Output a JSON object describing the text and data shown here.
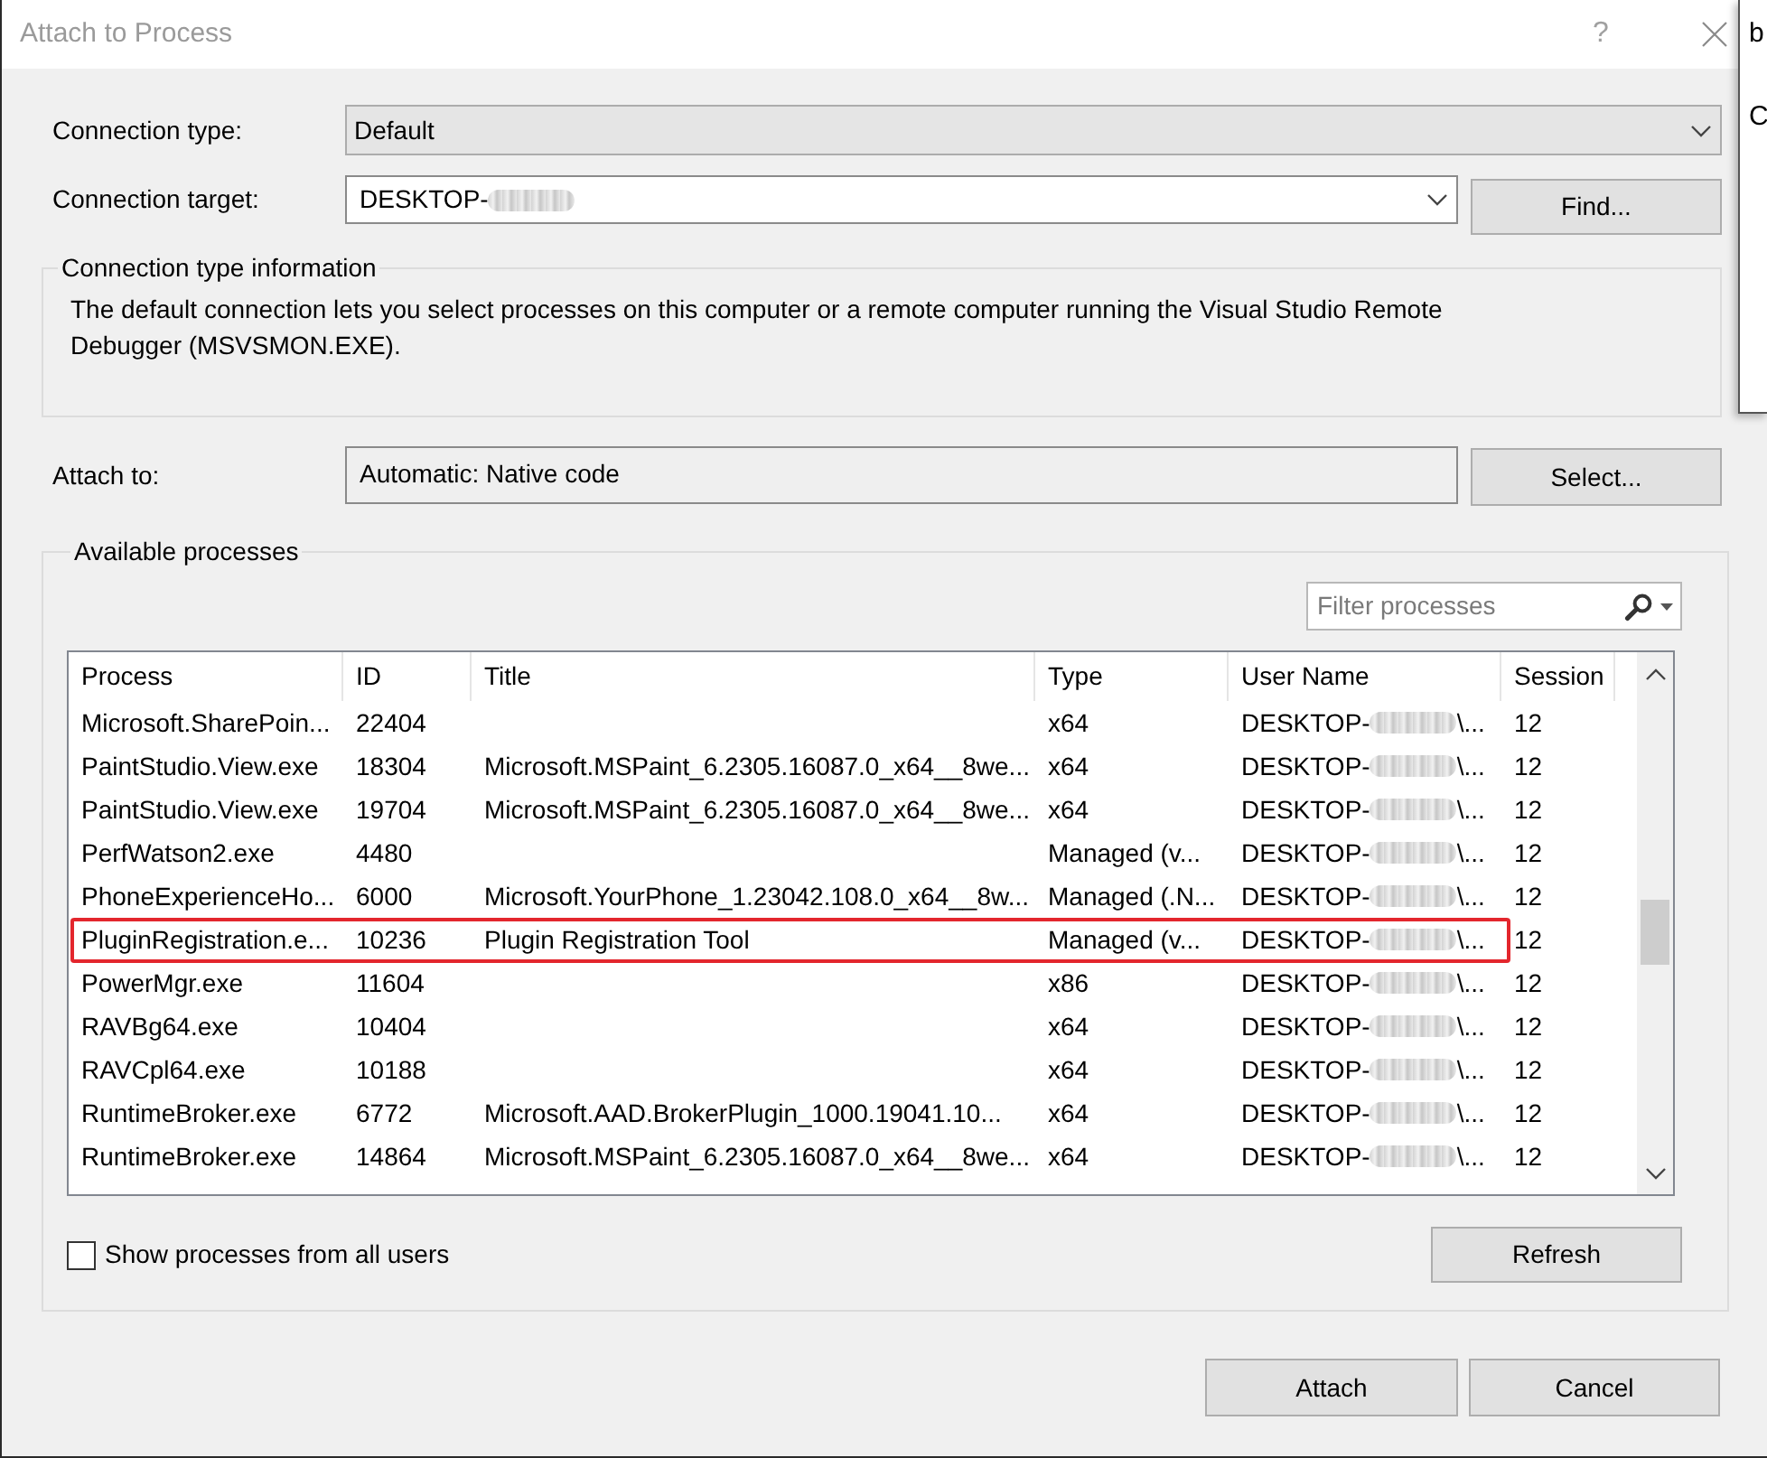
{
  "window": {
    "title": "Attach to Process",
    "help": "?"
  },
  "background_window": {
    "texts": [
      "b",
      "C"
    ]
  },
  "connection_type": {
    "label": "Connection type:",
    "value": "Default"
  },
  "connection_target": {
    "label": "Connection target:",
    "value": "DESKTOP-"
  },
  "find_button": "Find...",
  "connection_info": {
    "title": "Connection type information",
    "text": "The default connection lets you select processes on this computer or a remote computer running the Visual Studio Remote Debugger (MSVSMON.EXE)."
  },
  "attach_to": {
    "label": "Attach to:",
    "value": "Automatic: Native code"
  },
  "select_button": "Select...",
  "available_processes": {
    "title": "Available processes",
    "filter": {
      "placeholder": "Filter processes"
    },
    "columns": [
      "Process",
      "ID",
      "Title",
      "Type",
      "User Name",
      "Session"
    ],
    "rows": [
      {
        "process": "Microsoft.SharePoin...",
        "id": "22404",
        "type": "x64",
        "user_name": "DESKTOP-",
        "user_name_end": "\\...",
        "session": "12",
        "outlined": false
      },
      {
        "process": "PaintStudio.View.exe",
        "id": "18304",
        "title": "Microsoft.MSPaint_6.2305.16087.0_x64__8we...",
        "type": "x64",
        "user_name": "DESKTOP-",
        "user_name_end": "\\...",
        "session": "12",
        "outlined": false
      },
      {
        "process": "PaintStudio.View.exe",
        "id": "19704",
        "title": "Microsoft.MSPaint_6.2305.16087.0_x64__8we...",
        "type": "x64",
        "user_name": "DESKTOP-",
        "user_name_end": "\\...",
        "session": "12",
        "outlined": false
      },
      {
        "process": "PerfWatson2.exe",
        "id": "4480",
        "type": "Managed (v...",
        "user_name": "DESKTOP-",
        "user_name_end": "\\...",
        "session": "12",
        "outlined": false
      },
      {
        "process": "PhoneExperienceHo...",
        "id": "6000",
        "title": "Microsoft.YourPhone_1.23042.108.0_x64__8w...",
        "type": "Managed (.N...",
        "user_name": "DESKTOP-",
        "user_name_end": "\\...",
        "session": "12",
        "outlined": false
      },
      {
        "process": "PluginRegistration.e...",
        "id": "10236",
        "title": "Plugin Registration Tool",
        "type": "Managed (v...",
        "user_name": "DESKTOP-",
        "user_name_end": "\\...",
        "session": "12",
        "outlined": true
      },
      {
        "process": "PowerMgr.exe",
        "id": "11604",
        "type": "x86",
        "user_name": "DESKTOP-",
        "user_name_end": "\\...",
        "session": "12",
        "outlined": false
      },
      {
        "process": "RAVBg64.exe",
        "id": "10404",
        "type": "x64",
        "user_name": "DESKTOP-",
        "user_name_end": "\\...",
        "session": "12",
        "outlined": false
      },
      {
        "process": "RAVCpl64.exe",
        "id": "10188",
        "type": "x64",
        "user_name": "DESKTOP-",
        "user_name_end": "\\...",
        "session": "12",
        "outlined": false
      },
      {
        "process": "RuntimeBroker.exe",
        "id": "6772",
        "title": "Microsoft.AAD.BrokerPlugin_1000.19041.10...",
        "type": "x64",
        "user_name": "DESKTOP-",
        "user_name_end": "\\...",
        "session": "12",
        "outlined": false
      },
      {
        "process": "RuntimeBroker.exe",
        "id": "14864",
        "title": "Microsoft.MSPaint_6.2305.16087.0_x64__8we...",
        "type": "x64",
        "user_name": "DESKTOP-",
        "user_name_end": "\\...",
        "session": "12",
        "outlined": false
      }
    ]
  },
  "show_all_users": {
    "label": "Show processes from all users",
    "checked": false
  },
  "refresh_button": "Refresh",
  "buttons": [
    "Attach",
    "Cancel"
  ]
}
